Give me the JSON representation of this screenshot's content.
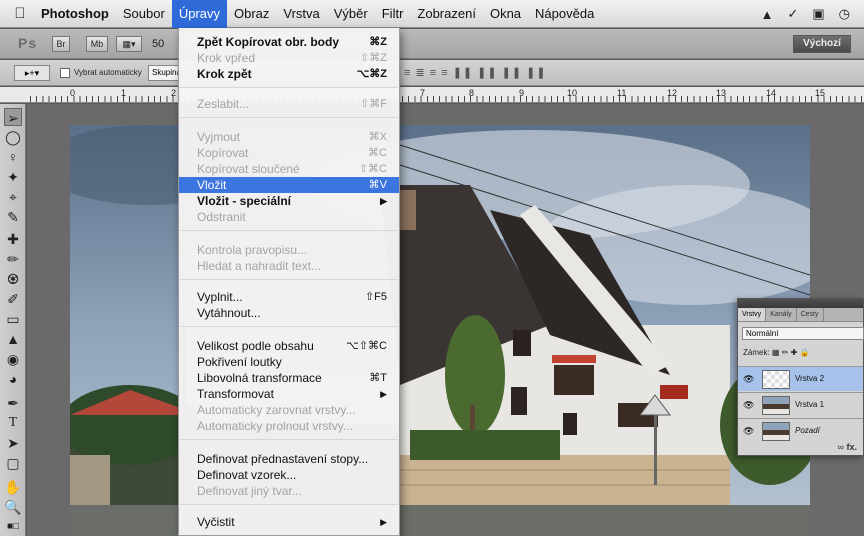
{
  "menubar": {
    "app": "Photoshop",
    "items": [
      "Soubor",
      "Úpravy",
      "Obraz",
      "Vrstva",
      "Výběr",
      "Filtr",
      "Zobrazení",
      "Okna",
      "Nápověda"
    ],
    "active_index": 1
  },
  "appbar": {
    "logo": "Ps",
    "zoom": "50",
    "workspace": "Výchozí"
  },
  "optbar": {
    "auto_select_label": "Vybrat automaticky",
    "auto_select_value": "Skupina"
  },
  "ruler": {
    "labels": [
      "0",
      "1",
      "2",
      "7",
      "8",
      "9",
      "10",
      "11",
      "12",
      "13",
      "14",
      "15"
    ]
  },
  "edit_menu": [
    {
      "label": "Zpět Kopírovat obr. body",
      "shortcut": "⌘Z",
      "enabled": true
    },
    {
      "label": "Krok vpřed",
      "shortcut": "⇧⌘Z",
      "enabled": false
    },
    {
      "label": "Krok zpět",
      "shortcut": "⌥⌘Z",
      "enabled": true
    },
    {
      "label": "Zeslabit...",
      "shortcut": "⇧⌘F",
      "enabled": false
    },
    {
      "label": "Vyjmout",
      "shortcut": "⌘X",
      "enabled": false
    },
    {
      "label": "Kopírovat",
      "shortcut": "⌘C",
      "enabled": false
    },
    {
      "label": "Kopírovat sloučené",
      "shortcut": "⇧⌘C",
      "enabled": false
    },
    {
      "label": "Vložit",
      "shortcut": "⌘V",
      "enabled": true,
      "highlighted": true
    },
    {
      "label": "Vložit - speciální",
      "shortcut": "",
      "submenu": true,
      "enabled": true
    },
    {
      "label": "Odstranit",
      "shortcut": "",
      "enabled": false
    },
    {
      "label": "Kontrola pravopisu...",
      "shortcut": "",
      "enabled": false
    },
    {
      "label": "Hledat a nahradit text...",
      "shortcut": "",
      "enabled": false
    },
    {
      "label": "Vyplnit...",
      "shortcut": "⇧F5",
      "enabled": true
    },
    {
      "label": "Vytáhnout...",
      "shortcut": "",
      "enabled": true
    },
    {
      "label": "Velikost podle obsahu",
      "shortcut": "⌥⇧⌘C",
      "enabled": true
    },
    {
      "label": "Pokřivení loutky",
      "shortcut": "",
      "enabled": true
    },
    {
      "label": "Libovolná transformace",
      "shortcut": "⌘T",
      "enabled": true
    },
    {
      "label": "Transformovat",
      "shortcut": "",
      "submenu": true,
      "enabled": true
    },
    {
      "label": "Automaticky zarovnat vrstvy...",
      "shortcut": "",
      "enabled": false
    },
    {
      "label": "Automaticky prolnout vrstvy...",
      "shortcut": "",
      "enabled": false
    },
    {
      "label": "Definovat přednastavení stopy...",
      "shortcut": "",
      "enabled": true
    },
    {
      "label": "Definovat vzorek...",
      "shortcut": "",
      "enabled": true
    },
    {
      "label": "Definovat jiný tvar...",
      "shortcut": "",
      "enabled": false
    },
    {
      "label": "Vyčistit",
      "shortcut": "",
      "submenu": true,
      "enabled": true
    }
  ],
  "layers_panel": {
    "tabs": [
      "Vrstvy",
      "Kanály",
      "Cesty"
    ],
    "blend_mode": "Normální",
    "lock_label": "Zámek:",
    "layers": [
      {
        "name": "Vrstva 2",
        "selected": true
      },
      {
        "name": "Vrstva 1",
        "selected": false
      },
      {
        "name": "Pozadí",
        "selected": false
      }
    ],
    "footer": "fx."
  },
  "toolbox_icons": [
    "move-tool-icon",
    "marquee-tool-icon",
    "lasso-tool-icon",
    "quick-select-tool-icon",
    "crop-tool-icon",
    "eyedropper-tool-icon",
    "healing-tool-icon",
    "brush-tool-icon",
    "stamp-tool-icon",
    "history-brush-icon",
    "eraser-tool-icon",
    "gradient-tool-icon",
    "blur-tool-icon",
    "dodge-tool-icon",
    "pen-tool-icon",
    "type-tool-icon",
    "path-select-tool-icon",
    "shape-tool-icon",
    "hand-tool-icon",
    "zoom-tool-icon"
  ]
}
